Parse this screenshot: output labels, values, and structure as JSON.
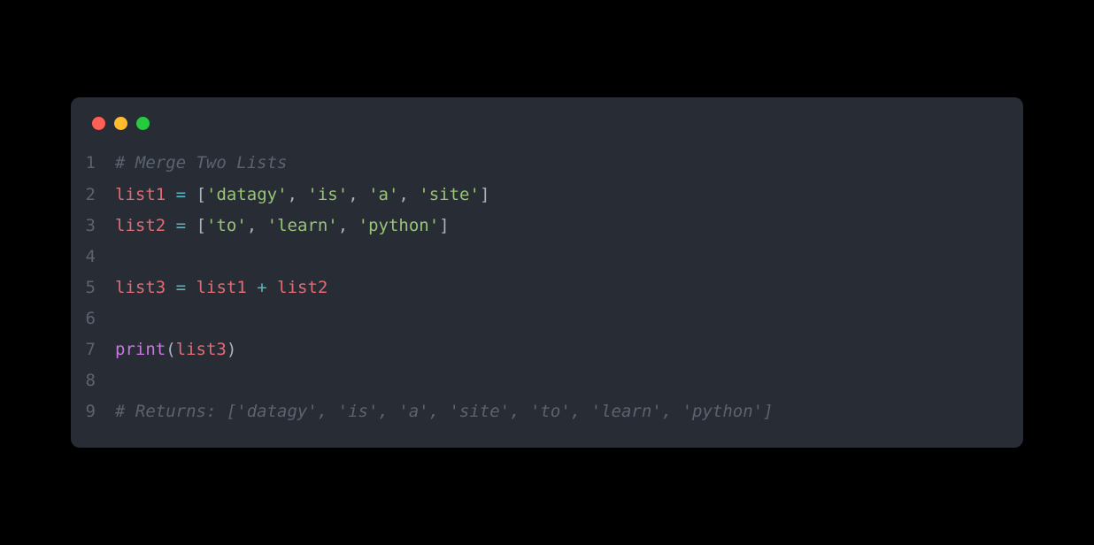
{
  "window": {
    "buttons": [
      "close",
      "minimize",
      "maximize"
    ]
  },
  "code": {
    "lines": [
      {
        "num": "1",
        "tokens": [
          {
            "cls": "comment",
            "text": "# Merge Two Lists"
          }
        ]
      },
      {
        "num": "2",
        "tokens": [
          {
            "cls": "ident",
            "text": "list1"
          },
          {
            "cls": "plain",
            "text": " "
          },
          {
            "cls": "op",
            "text": "="
          },
          {
            "cls": "plain",
            "text": " "
          },
          {
            "cls": "punct",
            "text": "["
          },
          {
            "cls": "str",
            "text": "'datagy'"
          },
          {
            "cls": "punct",
            "text": ", "
          },
          {
            "cls": "str",
            "text": "'is'"
          },
          {
            "cls": "punct",
            "text": ", "
          },
          {
            "cls": "str",
            "text": "'a'"
          },
          {
            "cls": "punct",
            "text": ", "
          },
          {
            "cls": "str",
            "text": "'site'"
          },
          {
            "cls": "punct",
            "text": "]"
          }
        ]
      },
      {
        "num": "3",
        "tokens": [
          {
            "cls": "ident",
            "text": "list2"
          },
          {
            "cls": "plain",
            "text": " "
          },
          {
            "cls": "op",
            "text": "="
          },
          {
            "cls": "plain",
            "text": " "
          },
          {
            "cls": "punct",
            "text": "["
          },
          {
            "cls": "str",
            "text": "'to'"
          },
          {
            "cls": "punct",
            "text": ", "
          },
          {
            "cls": "str",
            "text": "'learn'"
          },
          {
            "cls": "punct",
            "text": ", "
          },
          {
            "cls": "str",
            "text": "'python'"
          },
          {
            "cls": "punct",
            "text": "]"
          }
        ]
      },
      {
        "num": "4",
        "tokens": []
      },
      {
        "num": "5",
        "tokens": [
          {
            "cls": "ident",
            "text": "list3"
          },
          {
            "cls": "plain",
            "text": " "
          },
          {
            "cls": "op",
            "text": "="
          },
          {
            "cls": "plain",
            "text": " "
          },
          {
            "cls": "ident",
            "text": "list1"
          },
          {
            "cls": "plain",
            "text": " "
          },
          {
            "cls": "op",
            "text": "+"
          },
          {
            "cls": "plain",
            "text": " "
          },
          {
            "cls": "ident",
            "text": "list2"
          }
        ]
      },
      {
        "num": "6",
        "tokens": []
      },
      {
        "num": "7",
        "tokens": [
          {
            "cls": "func",
            "text": "print"
          },
          {
            "cls": "punct",
            "text": "("
          },
          {
            "cls": "ident",
            "text": "list3"
          },
          {
            "cls": "punct",
            "text": ")"
          }
        ]
      },
      {
        "num": "8",
        "tokens": []
      },
      {
        "num": "9",
        "tokens": [
          {
            "cls": "comment",
            "text": "# Returns: ['datagy', 'is', 'a', 'site', 'to', 'learn', 'python']"
          }
        ]
      }
    ]
  }
}
